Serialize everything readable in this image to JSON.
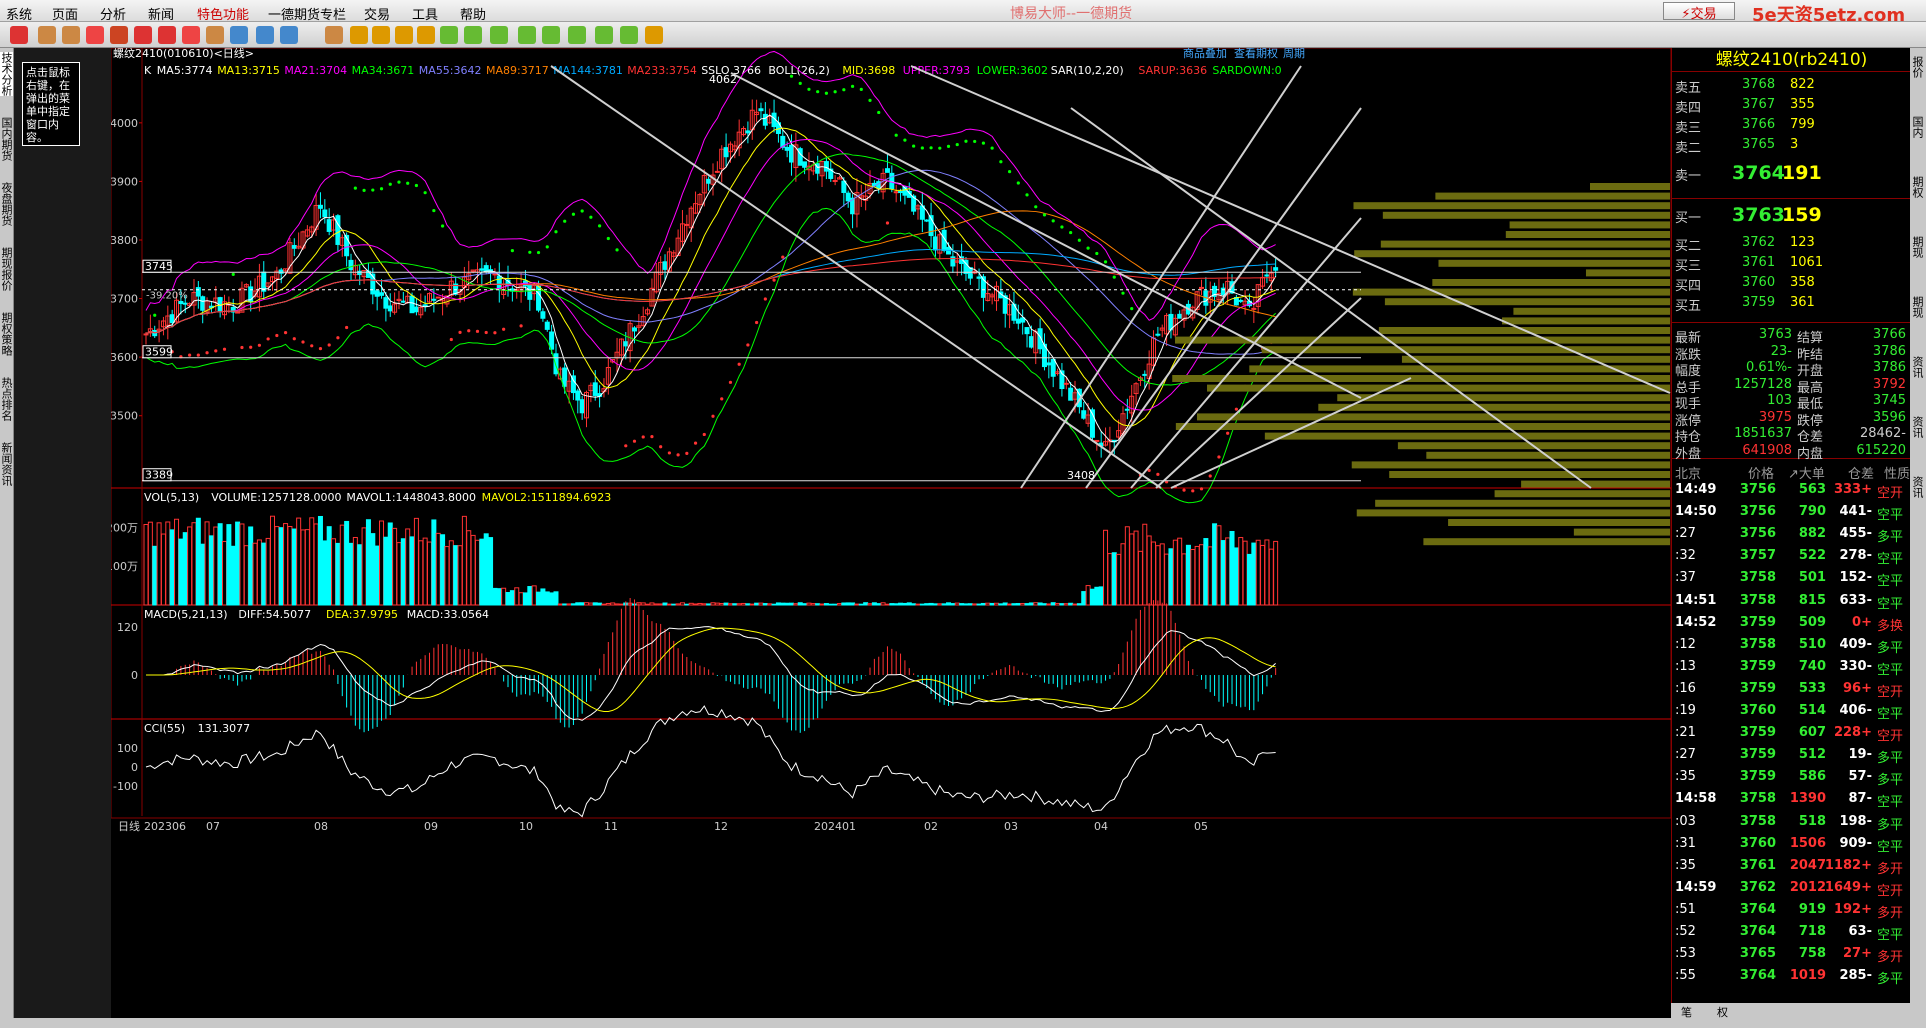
{
  "menu": {
    "items": [
      "系统",
      "页面",
      "分析",
      "新闻",
      "特色功能",
      "一德期货专栏",
      "交易",
      "工具",
      "帮助"
    ],
    "window_title": "博易大师--一德期货",
    "trade_button": "交易",
    "watermark": "5e天资5etz.com"
  },
  "left_panel": {
    "tabs": [
      "技术分析",
      "国内期货",
      "夜盘期货",
      "期现报价",
      "期权策略",
      "热点排名",
      "新闻资讯"
    ],
    "hint_text": "点击鼠标右键，在弹出的菜单中指定窗口内容。"
  },
  "right_edge": {
    "tabs": [
      "报价",
      "国内",
      "期权",
      "期现",
      "期现",
      "资讯",
      "资讯",
      "资讯"
    ]
  },
  "chart_header": {
    "symbol_line": "螺纹2410(010610)<日线>",
    "links": [
      "商品叠加",
      "查看期权",
      "周期"
    ]
  },
  "indicators": {
    "main_legend": [
      {
        "text": "K",
        "color": "#ffffff"
      },
      {
        "text": "MA5:3774",
        "color": "#ffffff"
      },
      {
        "text": "MA13:3715",
        "color": "#ffff00"
      },
      {
        "text": "MA21:3704",
        "color": "#ff00ff"
      },
      {
        "text": "MA34:3671",
        "color": "#00ff00"
      },
      {
        "text": "MA55:3642",
        "color": "#8080ff"
      },
      {
        "text": "MA89:3717",
        "color": "#ff8000"
      },
      {
        "text": "MA144:3781",
        "color": "#00aaff"
      },
      {
        "text": "MA233:3754",
        "color": "#ff3333"
      },
      {
        "text": "SSLO 3766",
        "color": "#ffffff"
      },
      {
        "text": "BOLL(26,2)",
        "color": "#ffffff"
      },
      {
        "text": "MID:3698",
        "color": "#ffff00"
      },
      {
        "text": "UPPER:3793",
        "color": "#ff00ff"
      },
      {
        "text": "LOWER:3602",
        "color": "#00ff00"
      },
      {
        "text": "SAR(10,2,20)",
        "color": "#ffffff"
      },
      {
        "text": "SARUP:3636",
        "color": "#ff3333"
      },
      {
        "text": "SARDOWN:0",
        "color": "#00ff00"
      }
    ],
    "vol_legend": [
      {
        "text": "VOL(5,13)",
        "color": "#ffffff"
      },
      {
        "text": "VOLUME:1257128.0000",
        "color": "#ffffff"
      },
      {
        "text": "MAVOL1:1448043.8000",
        "color": "#ffffff"
      },
      {
        "text": "MAVOL2:1511894.6923",
        "color": "#ffff00"
      }
    ],
    "macd_legend": [
      {
        "text": "MACD(5,21,13)",
        "color": "#ffffff"
      },
      {
        "text": "DIFF:54.5077",
        "color": "#ffffff"
      },
      {
        "text": "DEA:37.9795",
        "color": "#ffff00"
      },
      {
        "text": "MACD:33.0564",
        "color": "#ffffff"
      }
    ],
    "cci_legend": [
      {
        "text": "CCI(55)",
        "color": "#ffffff"
      },
      {
        "text": "131.3077",
        "color": "#ffffff"
      }
    ]
  },
  "chart_data": {
    "type": "candlestick",
    "price_axis": {
      "ticks": [
        "4000",
        "3900",
        "3800",
        "3700",
        "3600",
        "3500"
      ],
      "ylim": [
        3380,
        4080
      ]
    },
    "price_markers": {
      "high_label": "4062",
      "low_label": "3408",
      "left_top": "3745",
      "left_mid": "3599",
      "left_bottom": "3389",
      "pct_label": "-39.20%"
    },
    "vol_axis": {
      "ticks": [
        "200万",
        "100万"
      ]
    },
    "macd_axis": {
      "ticks": [
        "120",
        "0"
      ]
    },
    "cci_axis": {
      "ticks": [
        "100",
        "0",
        "-100"
      ]
    },
    "date_axis": {
      "label": "日线",
      "ticks": [
        "202306",
        "07",
        "08",
        "09",
        "10",
        "11",
        "12",
        "202401",
        "02",
        "03",
        "04",
        "05"
      ]
    },
    "close_series_anchor": [
      [
        0,
        3640
      ],
      [
        10,
        3700
      ],
      [
        20,
        3690
      ],
      [
        30,
        3740
      ],
      [
        40,
        3860
      ],
      [
        47,
        3760
      ],
      [
        55,
        3700
      ],
      [
        62,
        3680
      ],
      [
        70,
        3720
      ],
      [
        80,
        3740
      ],
      [
        90,
        3700
      ],
      [
        95,
        3560
      ],
      [
        100,
        3520
      ],
      [
        105,
        3560
      ],
      [
        115,
        3700
      ],
      [
        125,
        3860
      ],
      [
        132,
        3950
      ],
      [
        140,
        4020
      ],
      [
        148,
        3950
      ],
      [
        155,
        3930
      ],
      [
        162,
        3860
      ],
      [
        170,
        3900
      ],
      [
        178,
        3830
      ],
      [
        185,
        3760
      ],
      [
        192,
        3720
      ],
      [
        200,
        3670
      ],
      [
        208,
        3580
      ],
      [
        215,
        3500
      ],
      [
        220,
        3440
      ],
      [
        225,
        3520
      ],
      [
        232,
        3640
      ],
      [
        240,
        3700
      ],
      [
        248,
        3720
      ],
      [
        253,
        3670
      ],
      [
        258,
        3760
      ]
    ],
    "total_bars": 260
  },
  "quote": {
    "title": "螺纹2410(rb2410)",
    "asks": [
      {
        "label": "卖五",
        "price": "3768",
        "vol": "822"
      },
      {
        "label": "卖四",
        "price": "3767",
        "vol": "355"
      },
      {
        "label": "卖三",
        "price": "3766",
        "vol": "799"
      },
      {
        "label": "卖二",
        "price": "3765",
        "vol": "3"
      },
      {
        "label": "卖一",
        "price": "3764",
        "vol": "191"
      }
    ],
    "bids": [
      {
        "label": "买一",
        "price": "3763",
        "vol": "159"
      },
      {
        "label": "买二",
        "price": "3762",
        "vol": "123"
      },
      {
        "label": "买三",
        "price": "3761",
        "vol": "1061"
      },
      {
        "label": "买四",
        "price": "3760",
        "vol": "358"
      },
      {
        "label": "买五",
        "price": "3759",
        "vol": "361"
      }
    ],
    "stats": [
      [
        "最新",
        "3763",
        "结算",
        "3766"
      ],
      [
        "涨跌",
        "-23",
        "昨结",
        "3786"
      ],
      [
        "幅度",
        "-0.61%",
        "开盘",
        "3786"
      ],
      [
        "总手",
        "1257128",
        "最高",
        "3792"
      ],
      [
        "现手",
        "103",
        "最低",
        "3745"
      ],
      [
        "涨停",
        "3975",
        "跌停",
        "3596"
      ],
      [
        "持仓",
        "1851637",
        "仓差",
        "-28462"
      ],
      [
        "外盘",
        "641908",
        "内盘",
        "615220"
      ]
    ],
    "tick_header": [
      "北京",
      "价格",
      "↗大单",
      "仓差",
      "性质"
    ],
    "ticks": [
      [
        "14:49",
        "3756",
        "563",
        "+333",
        "空开"
      ],
      [
        "14:50",
        "3756",
        "790",
        "-441",
        "空平"
      ],
      [
        ":27",
        "3756",
        "882",
        "-455",
        "多平"
      ],
      [
        ":32",
        "3757",
        "522",
        "-278",
        "空平"
      ],
      [
        ":37",
        "3758",
        "501",
        "-152",
        "空平"
      ],
      [
        "14:51",
        "3758",
        "815",
        "-633",
        "空平"
      ],
      [
        "14:52",
        "3759",
        "509",
        "+0",
        "多换"
      ],
      [
        ":12",
        "3758",
        "510",
        "-409",
        "多平"
      ],
      [
        ":13",
        "3759",
        "740",
        "-330",
        "空平"
      ],
      [
        ":16",
        "3759",
        "533",
        "+96",
        "空开"
      ],
      [
        ":19",
        "3760",
        "514",
        "-406",
        "空平"
      ],
      [
        ":21",
        "3759",
        "607",
        "+228",
        "空开"
      ],
      [
        ":27",
        "3759",
        "512",
        "-19",
        "多平"
      ],
      [
        ":35",
        "3759",
        "586",
        "-57",
        "多平"
      ],
      [
        "14:58",
        "3758",
        "1390",
        "-87",
        "空平"
      ],
      [
        ":03",
        "3758",
        "518",
        "-198",
        "多平"
      ],
      [
        ":31",
        "3760",
        "1506",
        "-909",
        "空平"
      ],
      [
        ":35",
        "3761",
        "2047",
        "+1182",
        "多开"
      ],
      [
        "14:59",
        "3762",
        "2012",
        "+1649",
        "空开"
      ],
      [
        ":51",
        "3764",
        "919",
        "+192",
        "多开"
      ],
      [
        ":52",
        "3764",
        "718",
        "-63",
        "空平"
      ],
      [
        ":53",
        "3765",
        "758",
        "+27",
        "多开"
      ],
      [
        ":55",
        "3764",
        "1019",
        "-285",
        "多平"
      ]
    ],
    "bottom_tabs": [
      "笔",
      "权"
    ]
  }
}
